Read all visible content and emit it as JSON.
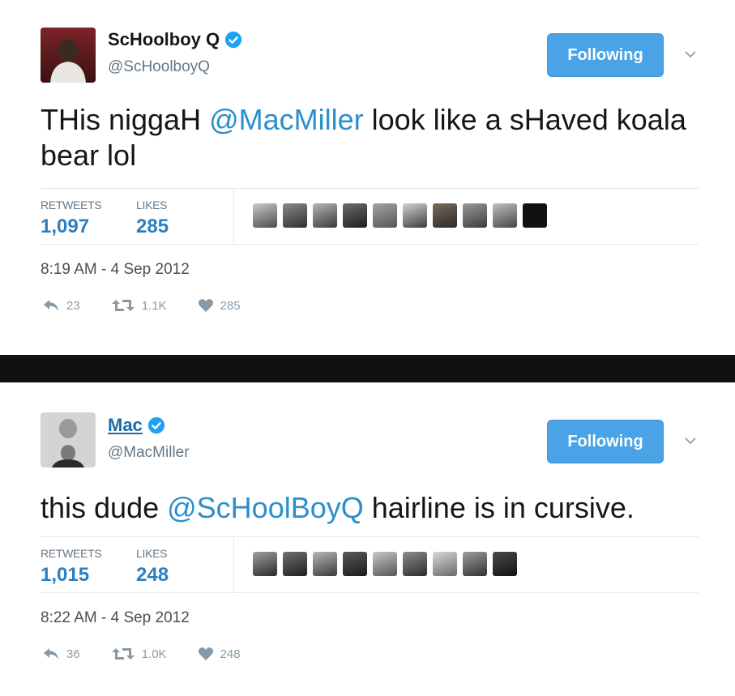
{
  "tweets": [
    {
      "display_name": "ScHoolboy Q",
      "handle": "@ScHoolboyQ",
      "follow_label": "Following",
      "text_before": "THis niggaH ",
      "mention": "@MacMiller",
      "text_after": " look like a sHaved koala bear lol",
      "retweets_label": "RETWEETS",
      "retweets": "1,097",
      "likes_label": "LIKES",
      "likes": "285",
      "timestamp": "8:19 AM - 4 Sep 2012",
      "reply_count": "23",
      "retweet_count": "1.1K",
      "like_count": "285"
    },
    {
      "display_name": "Mac",
      "handle": "@MacMiller",
      "follow_label": "Following",
      "text_before": "this dude ",
      "mention": "@ScHoolBoyQ",
      "text_after": " hairline is in cursive.",
      "retweets_label": "RETWEETS",
      "retweets": "1,015",
      "likes_label": "LIKES",
      "likes": "248",
      "timestamp": "8:22 AM - 4 Sep 2012",
      "reply_count": "36",
      "retweet_count": "1.0K",
      "like_count": "248"
    }
  ],
  "colors": {
    "follow_button": "#4aa3e6",
    "mention": "#2b8fc9",
    "stat_value": "#2b7fc0",
    "muted": "#8899a6",
    "separator": "#111111"
  },
  "icons": [
    "verified-badge-icon",
    "chevron-down-icon",
    "reply-icon",
    "retweet-icon",
    "heart-icon"
  ]
}
